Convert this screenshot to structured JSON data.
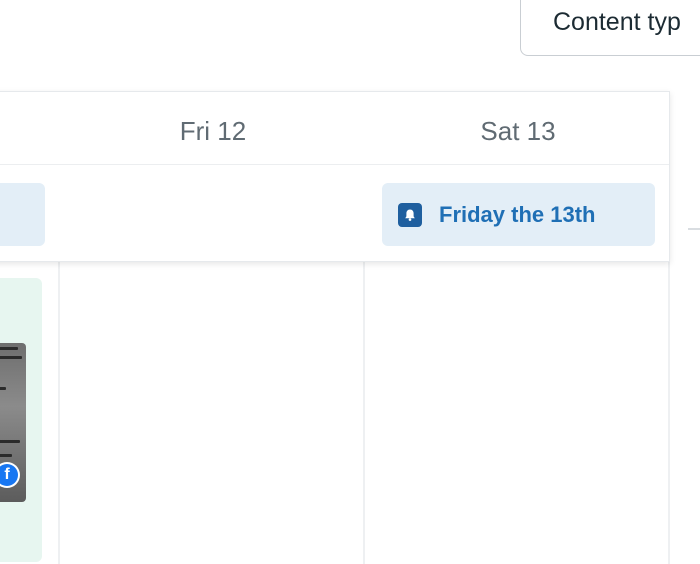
{
  "toolbar": {
    "content_type_label": "Content typ"
  },
  "calendar": {
    "days": [
      {
        "label": "Fri 12"
      },
      {
        "label": "Sat 13"
      }
    ],
    "all_day_event": {
      "title": "Friday the 13th",
      "icon": "bell-icon",
      "color": "#e3eef7",
      "text_color": "#1f6fb5"
    },
    "post": {
      "network_icon": "facebook-icon",
      "card_color": "#e7f6f0"
    }
  }
}
